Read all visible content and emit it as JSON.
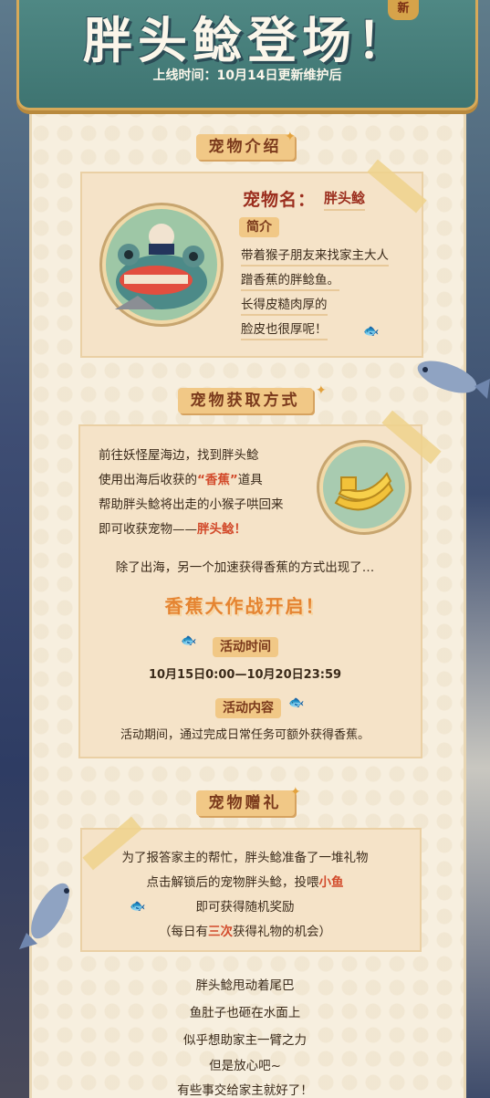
{
  "header": {
    "title": "胖头鲶登场！",
    "subtitle": "上线时间：10月14日更新维护后",
    "badge": "新"
  },
  "section_intro": {
    "title": "宠物介绍",
    "name_label": "宠物名：",
    "name_value": "胖头鲶",
    "intro_tag": "简介",
    "lines": [
      "带着猴子朋友来找家主大人",
      "蹭香蕉的胖鲶鱼。",
      "长得皮糙肉厚的",
      "脸皮也很厚呢！"
    ]
  },
  "section_obtain": {
    "title": "宠物获取方式",
    "lines": [
      "前往妖怪屋海边，找到胖头鲶",
      "使用出海后收获的",
      "帮助胖头鲶将出走的小猴子哄回来",
      "即可收获宠物——"
    ],
    "item_name": "“香蕉”",
    "item_suffix": "道具",
    "pet_name": "胖头鲶！",
    "extra_line": "除了出海，另一个加速获得香蕉的方式出现了…",
    "event_title": "香蕉大作战开启！",
    "time_tag": "活动时间",
    "time_value": "10月15日0:00—10月20日23:59",
    "content_tag": "活动内容",
    "content_value": "活动期间，通过完成日常任务可额外获得香蕉。"
  },
  "section_gift": {
    "title": "宠物赠礼",
    "line1": "为了报答家主的帮忙，胖头鲶准备了一堆礼物",
    "line2_prefix": "点击解锁后的宠物胖头鲶，投喂",
    "line2_hl": "小鱼",
    "line3": "即可获得随机奖励",
    "line4_prefix": "（每日有",
    "line4_hl": "三次",
    "line4_suffix": "获得礼物的机会）"
  },
  "footer_lines": [
    "胖头鲶甩动着尾巴",
    "鱼肚子也砸在水面上",
    "似乎想助家主一臂之力",
    "但是放心吧~",
    "有些事交给家主就好了！"
  ],
  "colors": {
    "banner": "#4f8884",
    "accent_red": "#9b2e1e",
    "highlight": "#d24a2b",
    "event_orange": "#e58431",
    "paper": "#f7efdf"
  }
}
